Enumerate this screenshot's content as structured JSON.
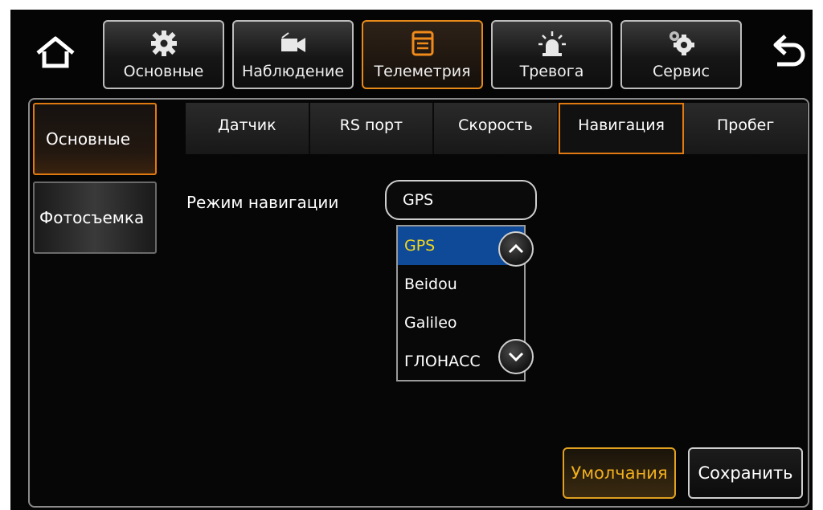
{
  "top_tabs": [
    {
      "label": "Основные",
      "icon": "gear-icon"
    },
    {
      "label": "Наблюдение",
      "icon": "video-camera-icon"
    },
    {
      "label": "Телеметрия",
      "icon": "telemetry-icon"
    },
    {
      "label": "Тревога",
      "icon": "alarm-light-icon"
    },
    {
      "label": "Сервис",
      "icon": "service-gears-icon"
    }
  ],
  "active_top_tab": "Телеметрия",
  "side_menu": [
    {
      "label": "Основные"
    },
    {
      "label": "Фотосъемка"
    }
  ],
  "sub_tabs": [
    {
      "label": "Датчик"
    },
    {
      "label": "RS порт"
    },
    {
      "label": "Скорость"
    },
    {
      "label": "Навигация"
    },
    {
      "label": "Пробег"
    }
  ],
  "active_sub_tab": "Навигация",
  "navigation": {
    "mode_label": "Режим навигации",
    "mode_value": "GPS",
    "options": [
      "GPS",
      "Beidou",
      "Galileo",
      "ГЛОНАСС"
    ]
  },
  "footer": {
    "default_label": "Умолчания",
    "save_label": "Сохранить"
  },
  "colors": {
    "accent": "#e07a10",
    "selected_bg": "#0e4a98",
    "selected_text": "#f2d61e",
    "default_btn_text": "#f2b01e"
  }
}
